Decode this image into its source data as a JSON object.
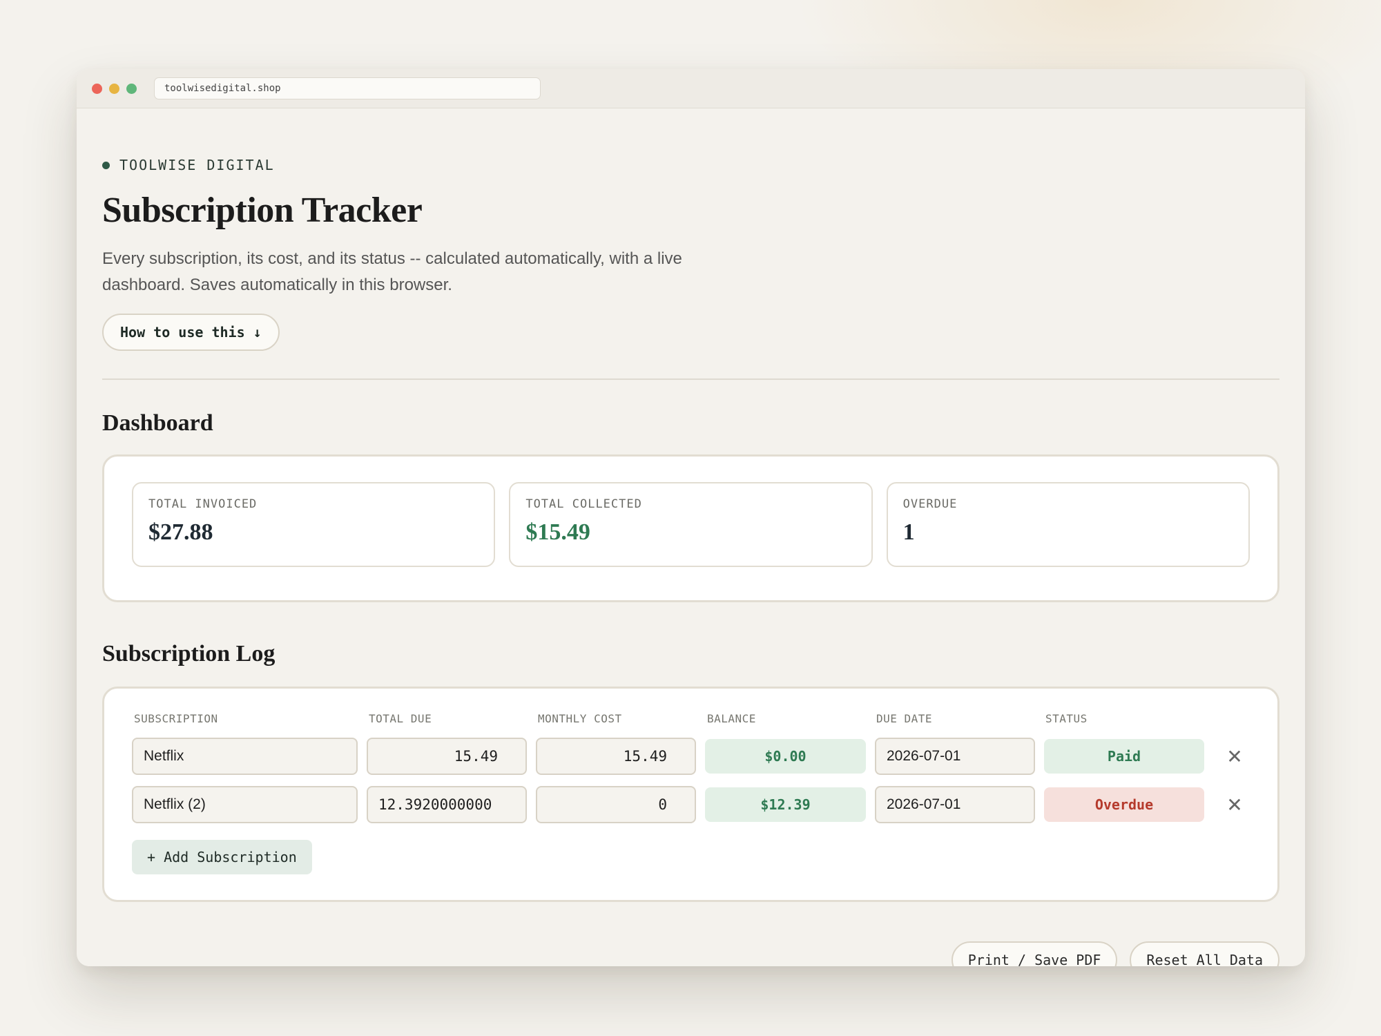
{
  "browser": {
    "url": "toolwisedigital.shop"
  },
  "brand": "TOOLWISE DIGITAL",
  "page": {
    "title": "Subscription Tracker",
    "subtitle": "Every subscription, its cost, and its status -- calculated automatically, with a live dashboard. Saves automatically in this browser.",
    "howto_label": "How to use this ↓"
  },
  "dashboard": {
    "title": "Dashboard",
    "stats": [
      {
        "label": "TOTAL INVOICED",
        "value": "$27.88"
      },
      {
        "label": "TOTAL COLLECTED",
        "value": "$15.49"
      },
      {
        "label": "OVERDUE",
        "value": "1"
      }
    ]
  },
  "log": {
    "title": "Subscription Log",
    "columns": [
      "SUBSCRIPTION",
      "TOTAL DUE",
      "MONTHLY COST",
      "BALANCE",
      "DUE DATE",
      "STATUS"
    ],
    "rows": [
      {
        "name": "Netflix",
        "total_due": "15.49",
        "monthly_cost": "15.49",
        "balance": "$0.00",
        "due_date": "2026-07-01",
        "status": "Paid"
      },
      {
        "name": "Netflix (2)",
        "total_due": "12.3920000000",
        "monthly_cost": "0",
        "balance": "$12.39",
        "due_date": "2026-07-01",
        "status": "Overdue"
      }
    ],
    "remove_icon": "✕",
    "add_label": "+ Add Subscription"
  },
  "footer": {
    "print_label": "Print / Save PDF",
    "reset_label": "Reset All Data"
  },
  "colors": {
    "accent_green": "#2e7a52",
    "overdue_red": "#b53a2c",
    "background": "#f4f2ed"
  }
}
